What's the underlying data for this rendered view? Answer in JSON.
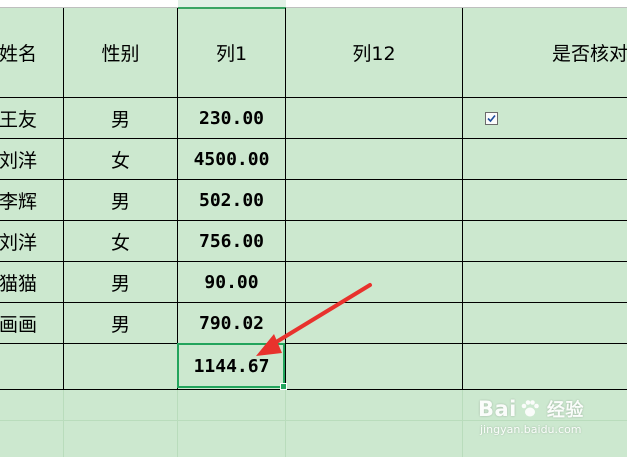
{
  "spreadsheet": {
    "headers": {
      "name": "姓名",
      "gender": "性别",
      "col1": "列1",
      "col12": "列12",
      "checked": "是否核对"
    },
    "rows": [
      {
        "name": "王友",
        "gender": "男",
        "col1": "230.00",
        "col12": "",
        "checked": true
      },
      {
        "name": "刘洋",
        "gender": "女",
        "col1": "4500.00",
        "col12": "",
        "checked": false
      },
      {
        "name": "李辉",
        "gender": "男",
        "col1": "502.00",
        "col12": "",
        "checked": false
      },
      {
        "name": "刘洋",
        "gender": "女",
        "col1": "756.00",
        "col12": "",
        "checked": false
      },
      {
        "name": "猫猫",
        "gender": "男",
        "col1": "90.00",
        "col12": "",
        "checked": false
      },
      {
        "name": "画画",
        "gender": "男",
        "col1": "790.02",
        "col12": "",
        "checked": false
      }
    ],
    "total": {
      "col1": "1144.67"
    },
    "selected_cell_color": "#22a45c",
    "background_color": "#cce8cf"
  },
  "annotation": {
    "arrow_color": "#e8322d"
  },
  "watermark": {
    "brand": "Bai",
    "brand_suffix": "经验",
    "url": "jingyan.baidu.com"
  }
}
